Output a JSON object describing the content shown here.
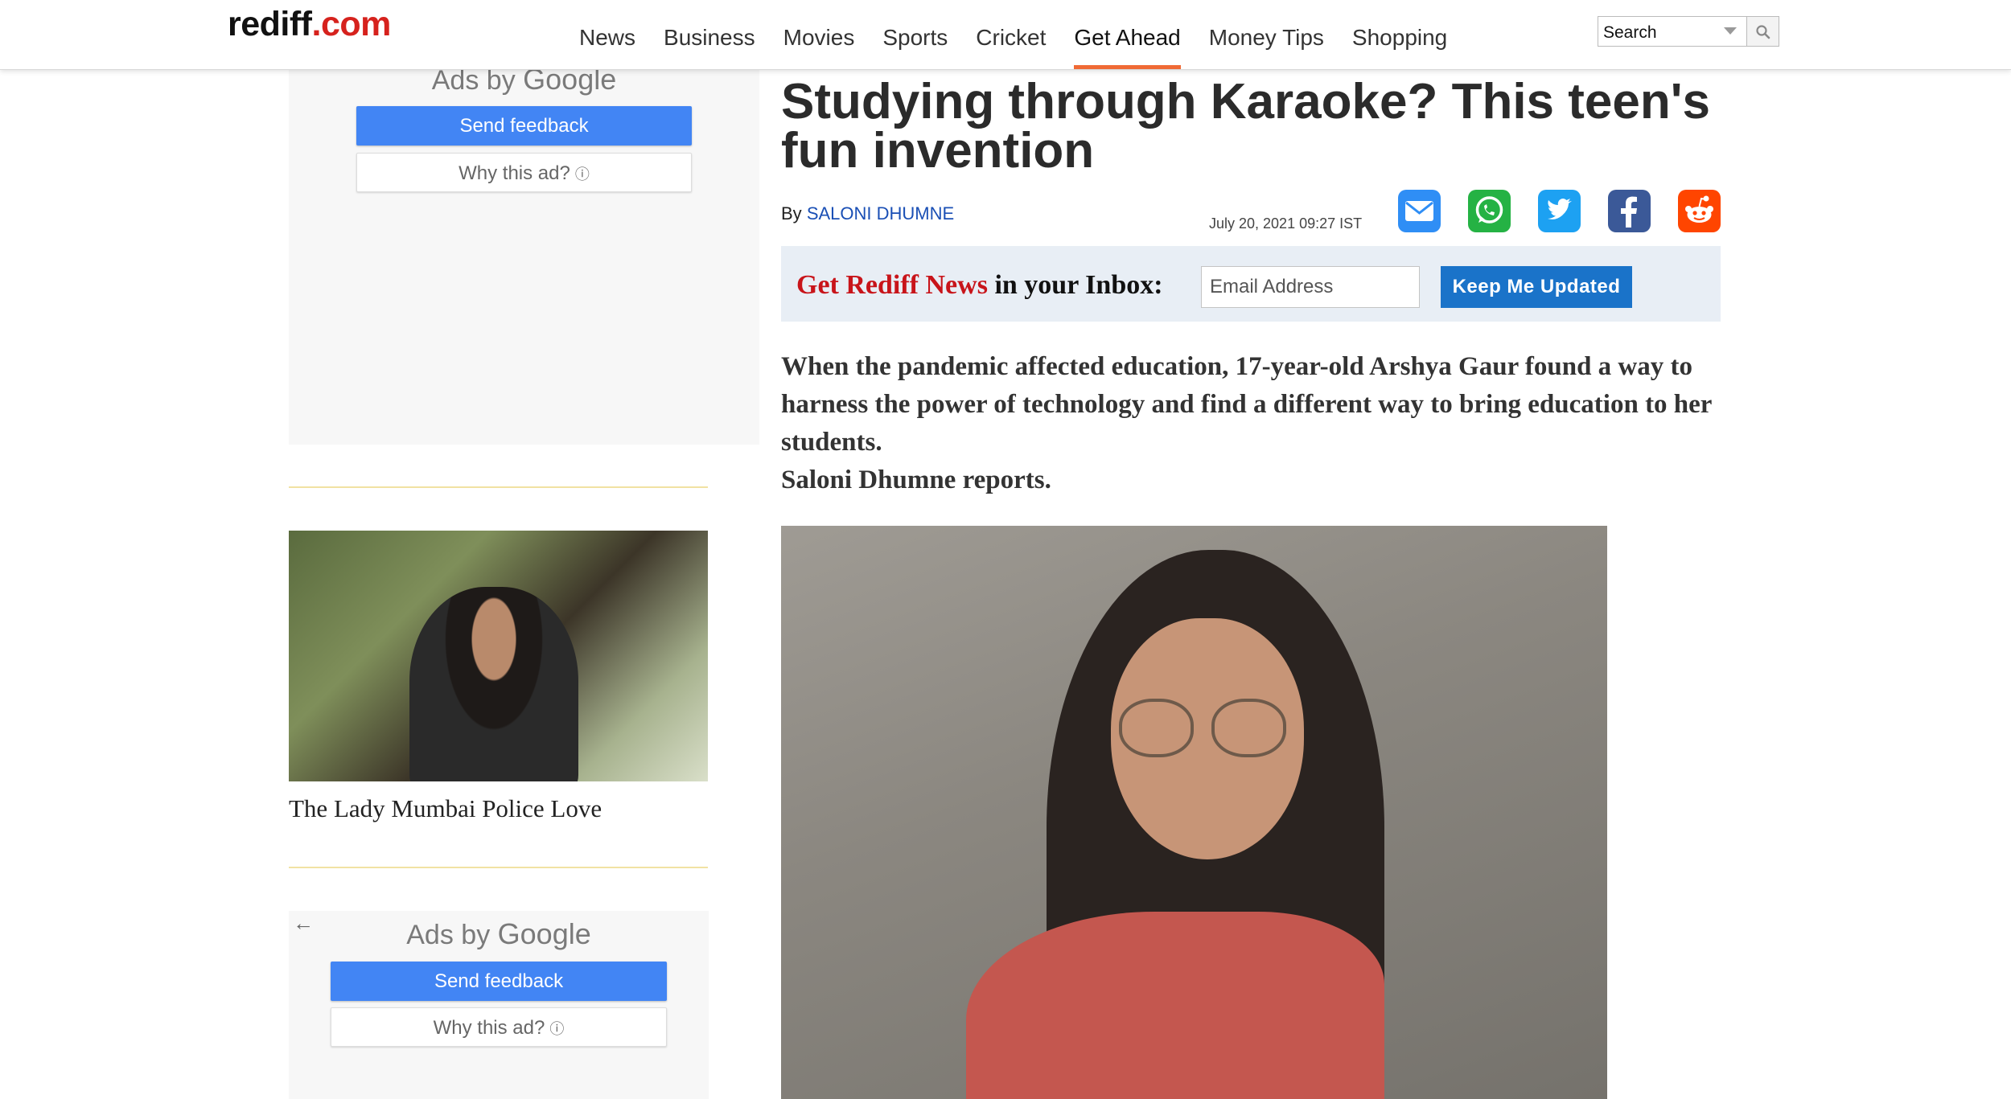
{
  "header": {
    "logo_part1": "rediff",
    "logo_part2": ".com",
    "nav": [
      "News",
      "Business",
      "Movies",
      "Sports",
      "Cricket",
      "Get Ahead",
      "Money Tips",
      "Shopping"
    ],
    "active_nav": "Get Ahead",
    "search_placeholder": "Search"
  },
  "left_column": {
    "ad_top": {
      "ads_by": "Ads by",
      "google": "Google",
      "send_feedback": "Send feedback",
      "why_this_ad": "Why this ad?"
    },
    "story": {
      "caption": "The Lady Mumbai Police Love"
    },
    "ad_bottom": {
      "ads_by": "Ads by",
      "google": "Google",
      "send_feedback": "Send feedback",
      "why_this_ad": "Why this ad?"
    }
  },
  "article": {
    "title": "Studying through Karaoke? This teen's fun invention",
    "by_prefix": "By",
    "author": "SALONI DHUMNE",
    "date": "July 20, 2021 09:27 IST",
    "share_icons": [
      "email-icon",
      "whatsapp-icon",
      "twitter-icon",
      "facebook-icon",
      "reddit-icon"
    ],
    "newsletter": {
      "label_red": "Get Rediff News",
      "label_rest": " in your Inbox:",
      "email_placeholder": "Email Address",
      "button": "Keep Me Updated"
    },
    "intro": "When the pandemic affected education, 17-year-old Arshya Gaur found a way to harness the power of technology and find a different way to bring education to her students.",
    "intro_byline": "Saloni Dhumne reports."
  },
  "colors": {
    "brand_red": "#d6221d",
    "nav_active_underline": "#f06a35",
    "google_blue": "#4285f4",
    "newsletter_bg": "#e8eef5",
    "keep_updated_btn": "#1a73c9",
    "author_link": "#1a4fb5"
  }
}
